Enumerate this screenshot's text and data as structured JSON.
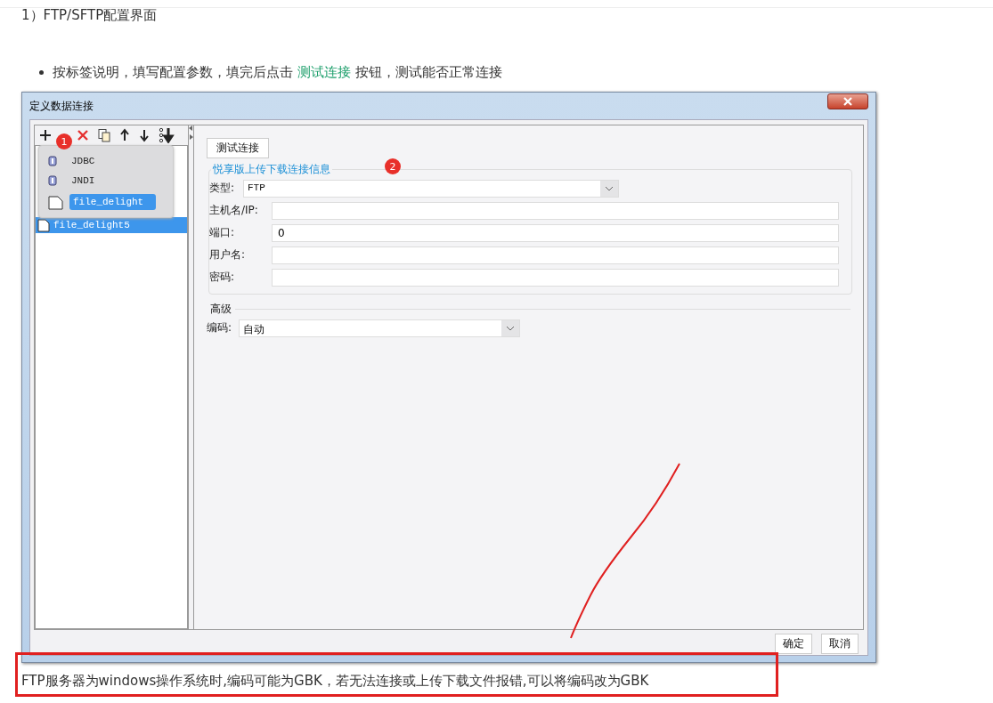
{
  "heading": "1）FTP/SFTP配置界面",
  "bullet": {
    "before": "按标签说明，填写配置参数，填完后点击 ",
    "link": "测试连接",
    "after": " 按钮，测试能否正常连接"
  },
  "dialog": {
    "title": "定义数据连接",
    "tree": [
      {
        "label": "file_delight5",
        "selected": true
      }
    ],
    "menu": [
      {
        "label": "JDBC",
        "kind": "db",
        "selected": false
      },
      {
        "label": "JNDI",
        "kind": "db",
        "selected": false
      },
      {
        "label": "file_delight",
        "kind": "folder",
        "selected": true
      }
    ],
    "badges": [
      "1",
      "2"
    ],
    "test_button": "测试连接",
    "group_title": "悦享版上传下载连接信息",
    "fields": [
      {
        "label": "类型:",
        "kind": "select",
        "value": "FTP"
      },
      {
        "label": "主机名/IP:",
        "kind": "text"
      },
      {
        "label": "端口:",
        "kind": "text",
        "value": "0"
      },
      {
        "label": "用户名:",
        "kind": "text"
      },
      {
        "label": "密码:",
        "kind": "text"
      }
    ],
    "advanced": {
      "title": "高级",
      "label": "编码:",
      "value": "自动"
    },
    "buttons": [
      "确定",
      "取消"
    ]
  },
  "note": "FTP服务器为windows操作系统时,编码可能为GBK，若无法连接或上传下载文件报错,可以将编码改为GBK"
}
